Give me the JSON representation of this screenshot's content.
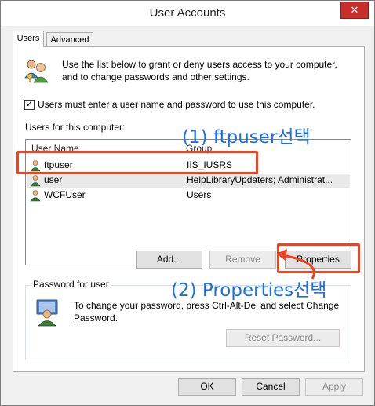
{
  "window": {
    "title": "User Accounts",
    "close_symbol": "✕"
  },
  "tabs": [
    {
      "label": "Users"
    },
    {
      "label": "Advanced"
    }
  ],
  "intro_text": "Use the list below to grant or deny users access to your computer, and to change passwords and other settings.",
  "require_login": {
    "checked": true,
    "check_symbol": "✓",
    "label": "Users must enter a user name and password to use this computer."
  },
  "users_list": {
    "label": "Users for this computer:",
    "columns": [
      "User Name",
      "Group"
    ],
    "rows": [
      {
        "name": "ftpuser",
        "group": "IIS_IUSRS"
      },
      {
        "name": "user",
        "group": "HelpLibraryUpdaters; Administrat..."
      },
      {
        "name": "WCFUser",
        "group": "Users"
      }
    ]
  },
  "buttons": {
    "add": "Add...",
    "remove": "Remove",
    "properties": "Properties"
  },
  "password_group": {
    "title": "Password for user",
    "text": "To change your password, press Ctrl-Alt-Del and select Change Password.",
    "reset_button": "Reset Password..."
  },
  "footer": {
    "ok": "OK",
    "cancel": "Cancel",
    "apply": "Apply"
  },
  "annotations": {
    "step1": "(1) ftpuser선택",
    "step2": "(2) Properties선택"
  },
  "colors": {
    "annotation_text": "#1a6fe8",
    "annotation_box": "#f0431d",
    "close_button": "#c7302a"
  }
}
